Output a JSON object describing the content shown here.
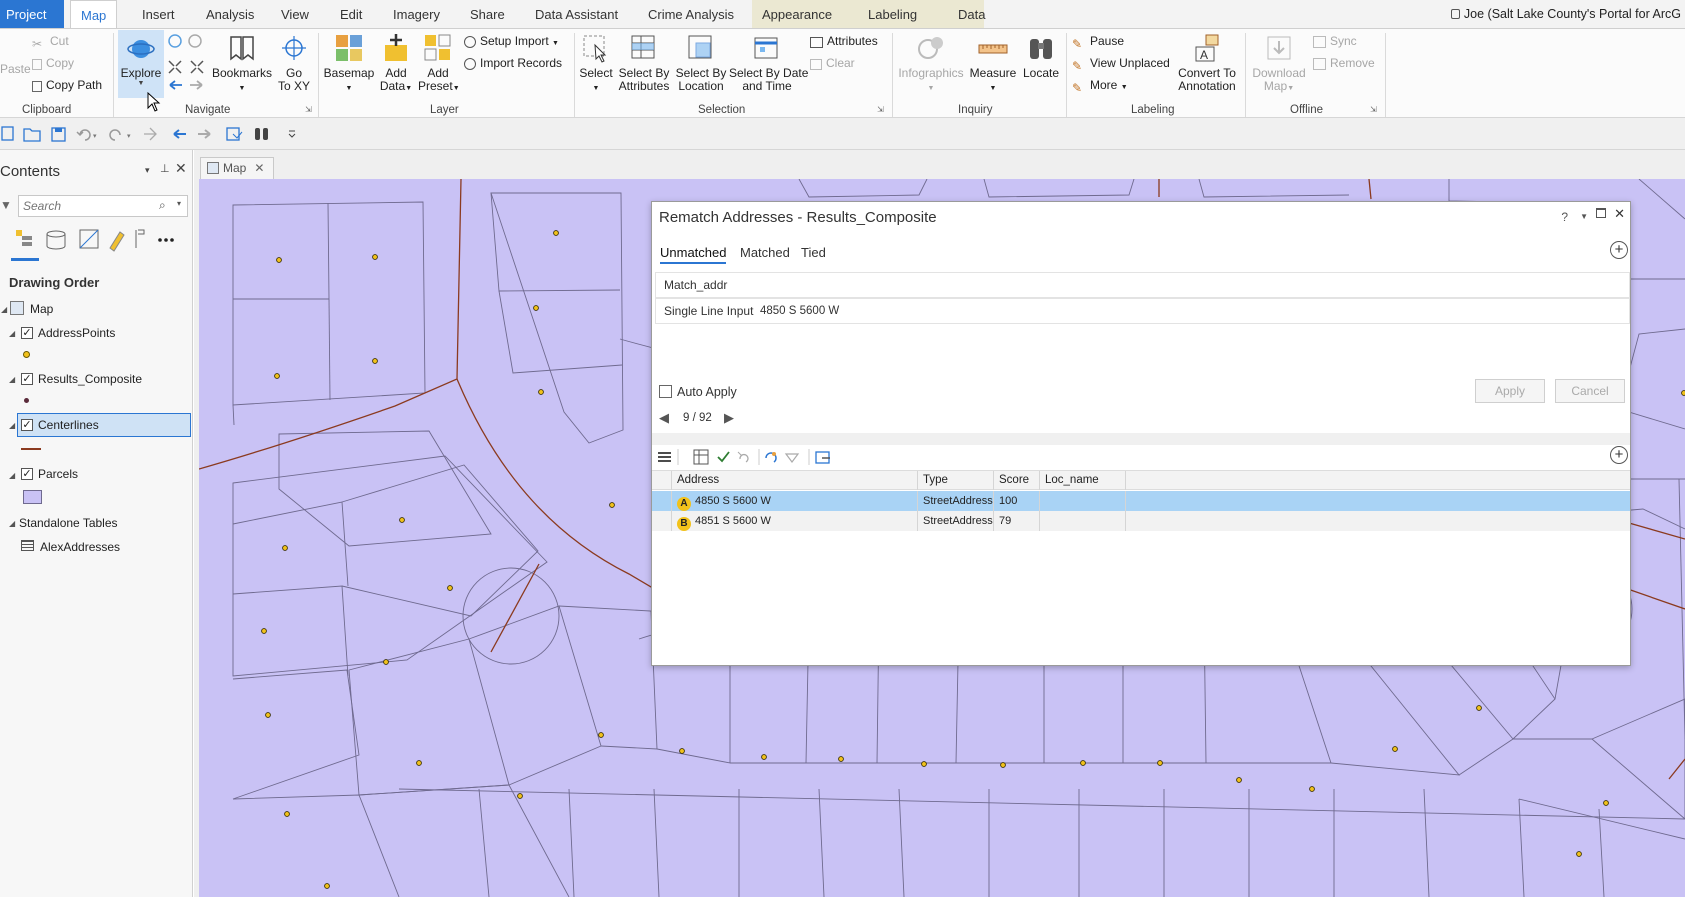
{
  "tabs": {
    "project": "Project",
    "map": "Map",
    "insert": "Insert",
    "analysis": "Analysis",
    "view": "View",
    "edit": "Edit",
    "imagery": "Imagery",
    "share": "Share",
    "data_assistant": "Data Assistant",
    "crime_analysis": "Crime Analysis",
    "appearance": "Appearance",
    "labeling": "Labeling",
    "data": "Data"
  },
  "user": "Joe (Salt Lake County's Portal for ArcG",
  "ribbon": {
    "clipboard": {
      "paste": "Paste",
      "cut": "Cut",
      "copy": "Copy",
      "copy_path": "Copy Path",
      "label": "Clipboard"
    },
    "navigate": {
      "explore": "Explore",
      "bookmarks": "Bookmarks",
      "go_to_xy_1": "Go",
      "go_to_xy_2": "To XY",
      "label": "Navigate"
    },
    "layer": {
      "basemap": "Basemap",
      "add_data_1": "Add",
      "add_data_2": "Data",
      "add_preset_1": "Add",
      "add_preset_2": "Preset",
      "setup_import": "Setup Import",
      "import_records": "Import Records",
      "label": "Layer"
    },
    "selection": {
      "select": "Select",
      "select_by_attr_1": "Select By",
      "select_by_attr_2": "Attributes",
      "select_by_loc_1": "Select By",
      "select_by_loc_2": "Location",
      "select_by_date_1": "Select By Date",
      "select_by_date_2": "and Time",
      "attributes": "Attributes",
      "clear": "Clear",
      "label": "Selection"
    },
    "inquiry": {
      "infographics": "Infographics",
      "measure": "Measure",
      "locate": "Locate",
      "label": "Inquiry"
    },
    "labeling": {
      "pause": "Pause",
      "view_unplaced": "View Unplaced",
      "more": "More",
      "convert_1": "Convert To",
      "convert_2": "Annotation",
      "label": "Labeling"
    },
    "offline": {
      "download_1": "Download",
      "download_2": "Map",
      "sync": "Sync",
      "remove": "Remove",
      "label": "Offline"
    }
  },
  "contents": {
    "title": "Contents",
    "search_placeholder": "Search",
    "drawing_order": "Drawing Order",
    "map": "Map",
    "layers": [
      "AddressPoints",
      "Results_Composite",
      "Centerlines",
      "Parcels"
    ],
    "standalone_tables": "Standalone Tables",
    "table": "AlexAddresses"
  },
  "map_tab": "Map",
  "dialog": {
    "title": "Rematch Addresses - Results_Composite",
    "tabs": [
      "Unmatched",
      "Matched",
      "Tied"
    ],
    "match_addr_label": "Match_addr",
    "single_line_label": "Single Line Input",
    "single_line_value": "4850 S 5600 W",
    "auto_apply": "Auto Apply",
    "apply": "Apply",
    "cancel": "Cancel",
    "pager": "9 / 92",
    "columns": [
      "Address",
      "Type",
      "Score",
      "Loc_name"
    ],
    "rows": [
      {
        "badge": "A",
        "address": "4850 S 5600 W",
        "type": "StreetAddress",
        "score": "100",
        "loc_name": ""
      },
      {
        "badge": "B",
        "address": "4851 S 5600 W",
        "type": "StreetAddress",
        "score": "79",
        "loc_name": ""
      }
    ]
  },
  "colors": {
    "accent": "#2b76d2",
    "parcel_fill": "#c9c2f5",
    "centerline": "#8b3a1f",
    "point": "#f2c21b",
    "selected_row": "#a9d3f5"
  }
}
